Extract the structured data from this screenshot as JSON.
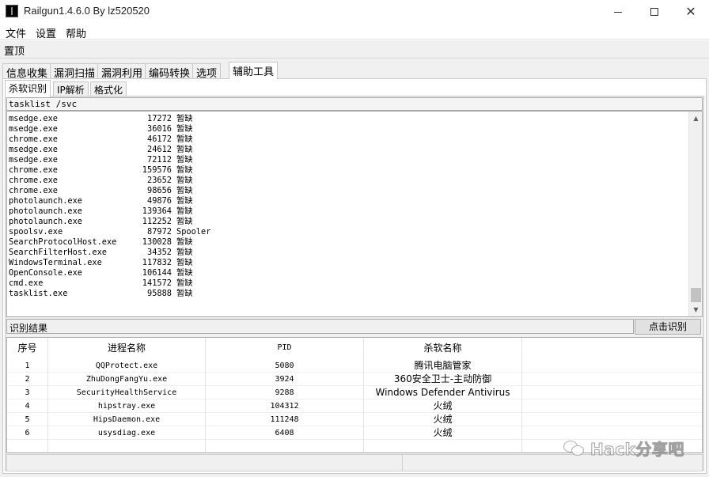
{
  "window": {
    "title": "Railgun1.4.6.0 By lz520520",
    "controls": {
      "minimize": "minimize-icon",
      "maximize": "maximize-icon",
      "close": "close-icon"
    }
  },
  "menu": {
    "file": "文件",
    "settings": "设置",
    "help": "帮助"
  },
  "pin_label": "置顶",
  "main_tabs": [
    "信息收集",
    "漏洞扫描",
    "漏洞利用",
    "编码转换",
    "选项",
    "辅助工具"
  ],
  "main_tabs_active": "辅助工具",
  "sub_tabs": [
    "杀软识别",
    "IP解析",
    "格式化"
  ],
  "sub_tabs_active": "杀软识别",
  "command": "tasklist /svc",
  "processes": [
    {
      "name": "msedge.exe",
      "pid": "17272",
      "svc": "暂缺"
    },
    {
      "name": "msedge.exe",
      "pid": "36016",
      "svc": "暂缺"
    },
    {
      "name": "chrome.exe",
      "pid": "46172",
      "svc": "暂缺"
    },
    {
      "name": "msedge.exe",
      "pid": "24612",
      "svc": "暂缺"
    },
    {
      "name": "msedge.exe",
      "pid": "72112",
      "svc": "暂缺"
    },
    {
      "name": "chrome.exe",
      "pid": "159576",
      "svc": "暂缺"
    },
    {
      "name": "chrome.exe",
      "pid": "23652",
      "svc": "暂缺"
    },
    {
      "name": "chrome.exe",
      "pid": "98656",
      "svc": "暂缺"
    },
    {
      "name": "photolaunch.exe",
      "pid": "49876",
      "svc": "暂缺"
    },
    {
      "name": "photolaunch.exe",
      "pid": "139364",
      "svc": "暂缺"
    },
    {
      "name": "photolaunch.exe",
      "pid": "112252",
      "svc": "暂缺"
    },
    {
      "name": "spoolsv.exe",
      "pid": "87972",
      "svc": "Spooler"
    },
    {
      "name": "SearchProtocolHost.exe",
      "pid": "130028",
      "svc": "暂缺"
    },
    {
      "name": "SearchFilterHost.exe",
      "pid": "34352",
      "svc": "暂缺"
    },
    {
      "name": "WindowsTerminal.exe",
      "pid": "117832",
      "svc": "暂缺"
    },
    {
      "name": "OpenConsole.exe",
      "pid": "106144",
      "svc": "暂缺"
    },
    {
      "name": "cmd.exe",
      "pid": "141572",
      "svc": "暂缺"
    },
    {
      "name": "tasklist.exe",
      "pid": "95888",
      "svc": "暂缺"
    }
  ],
  "result_label": "识别结果",
  "identify_button": "点击识别",
  "result_table": {
    "headers": [
      "序号",
      "进程名称",
      "PID",
      "杀软名称",
      ""
    ],
    "rows": [
      {
        "idx": "1",
        "process": "QQProtect.exe",
        "pid": "5080",
        "av": "腾讯电脑管家"
      },
      {
        "idx": "2",
        "process": "ZhuDongFangYu.exe",
        "pid": "3924",
        "av": "360安全卫士-主动防御"
      },
      {
        "idx": "3",
        "process": "SecurityHealthService",
        "pid": "9288",
        "av": "Windows Defender Antivirus"
      },
      {
        "idx": "4",
        "process": "hipstray.exe",
        "pid": "104312",
        "av": "火绒"
      },
      {
        "idx": "5",
        "process": "HipsDaemon.exe",
        "pid": "111248",
        "av": "火绒"
      },
      {
        "idx": "6",
        "process": "usysdiag.exe",
        "pid": "6408",
        "av": "火绒"
      }
    ]
  },
  "watermark": "Hack分享吧"
}
